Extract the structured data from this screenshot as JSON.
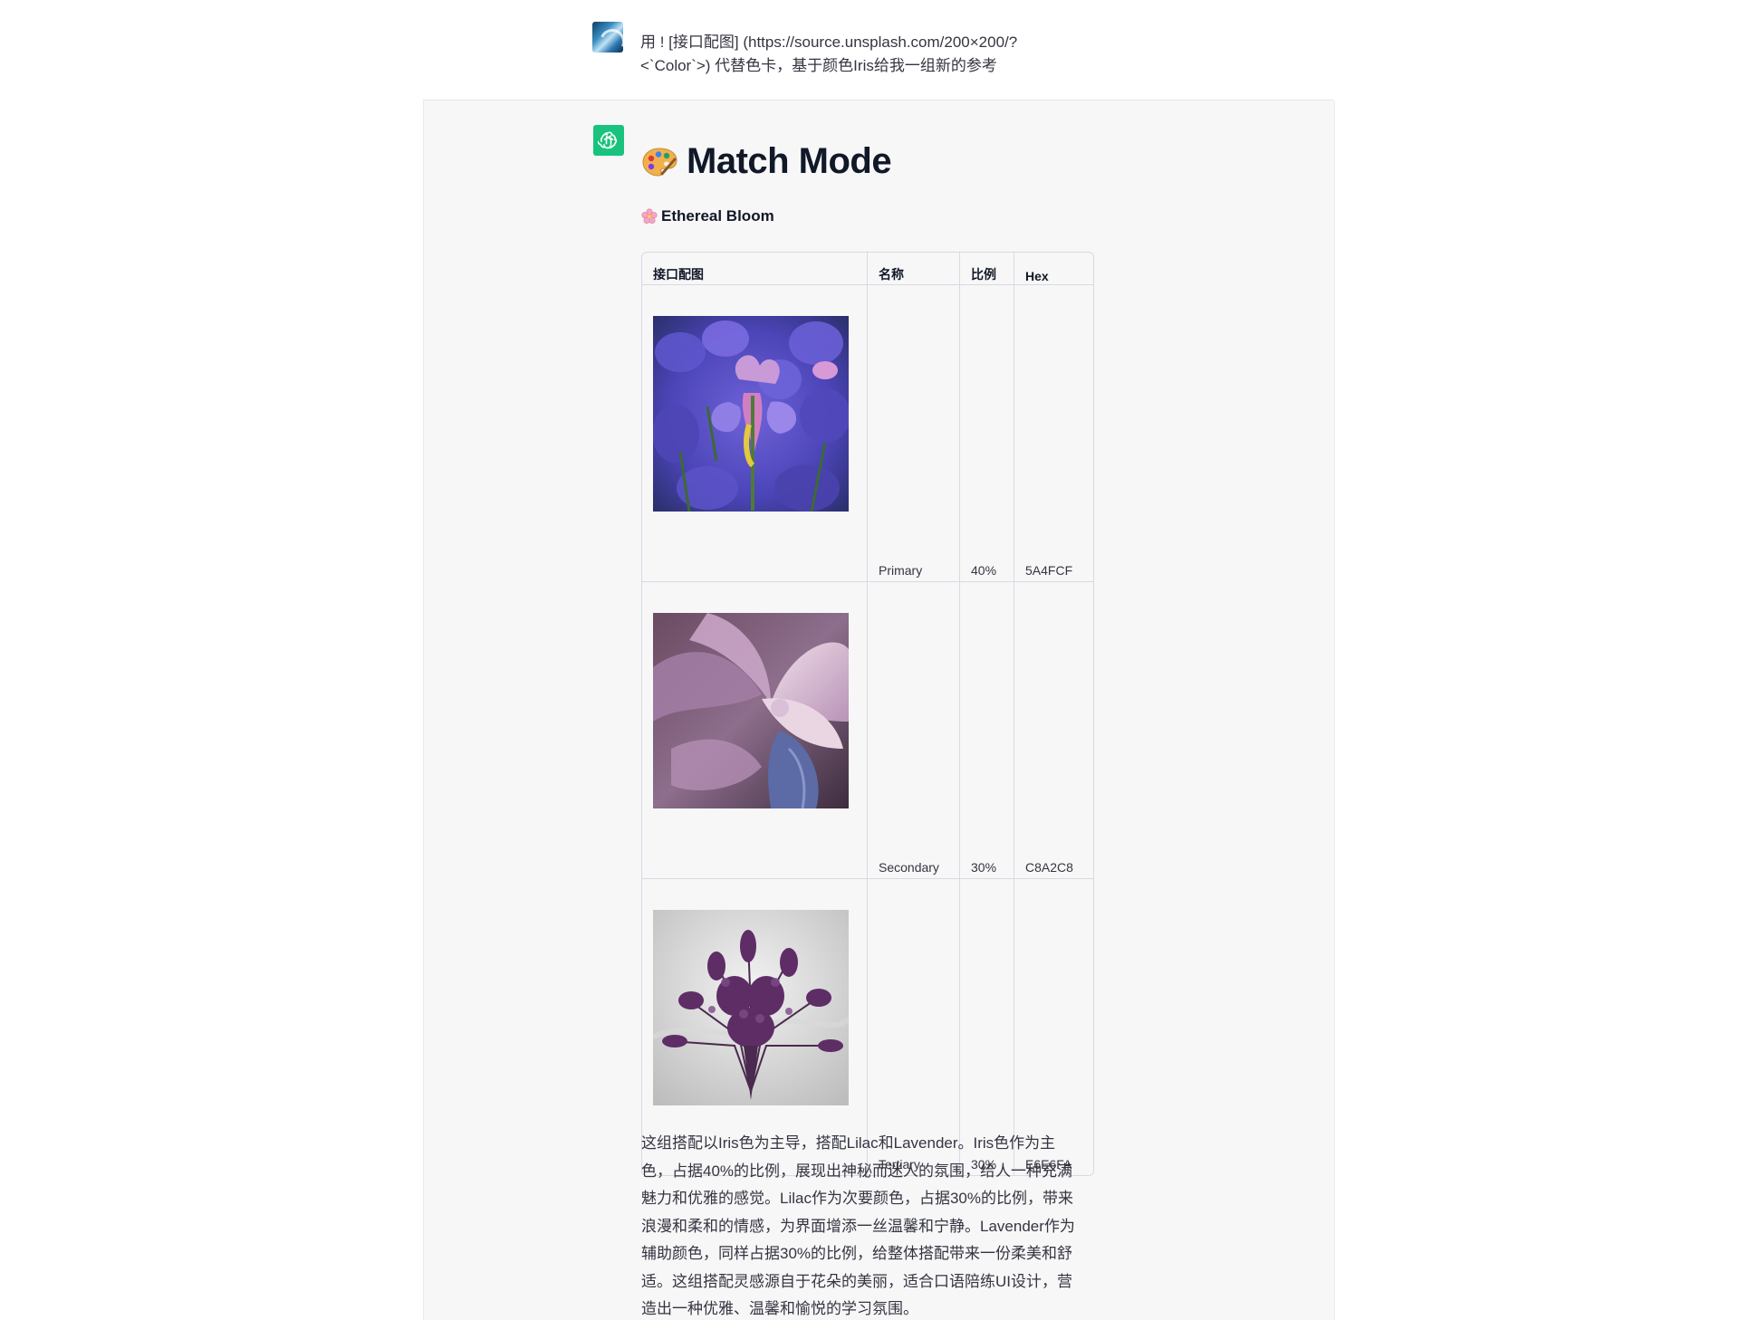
{
  "user_message": {
    "line1": "用 ! [接口配图] (https://source.unsplash.com/200×200/?",
    "line2": "<`Color`>) 代替色卡，基于颜色Iris给我一组新的参考"
  },
  "assistant": {
    "title": "Match Mode",
    "title_icon": "artist-palette-icon",
    "subtitle": "Ethereal Bloom",
    "subtitle_icon": "cherry-blossom-icon",
    "table": {
      "headers": [
        "接口配图",
        "名称",
        "比例",
        "Hex"
      ],
      "rows": [
        {
          "image": "iris-flowers-image",
          "name": "Primary",
          "ratio": "40%",
          "hex": "5A4FCF",
          "color": "#5A4FCF"
        },
        {
          "image": "lilac-flower-image",
          "name": "Secondary",
          "ratio": "30%",
          "hex": "C8A2C8",
          "color": "#C8A2C8"
        },
        {
          "image": "lavender-bouquet-image",
          "name": "Tertiary",
          "ratio": "30%",
          "hex": "E6E6FA",
          "color": "#E6E6FA"
        }
      ]
    },
    "description": "这组搭配以Iris色为主导，搭配Lilac和Lavender。Iris色作为主色，占据40%的比例，展现出神秘而迷人的氛围，给人一种充满魅力和优雅的感觉。Lilac作为次要颜色，占据30%的比例，带来浪漫和柔和的情感，为界面增添一丝温馨和宁静。Lavender作为辅助颜色，同样占据30%的比例，给整体搭配带来一份柔美和舒适。这组搭配灵感源自于花朵的美丽，适合口语陪练UI设计，营造出一种优雅、温馨和愉悦的学习氛围。"
  },
  "colors": {
    "assistant_bg": "#f7f7f8",
    "assistant_avatar": "#19c37d",
    "text": "#343541",
    "heading": "#111827",
    "border": "#d9d9e3"
  }
}
